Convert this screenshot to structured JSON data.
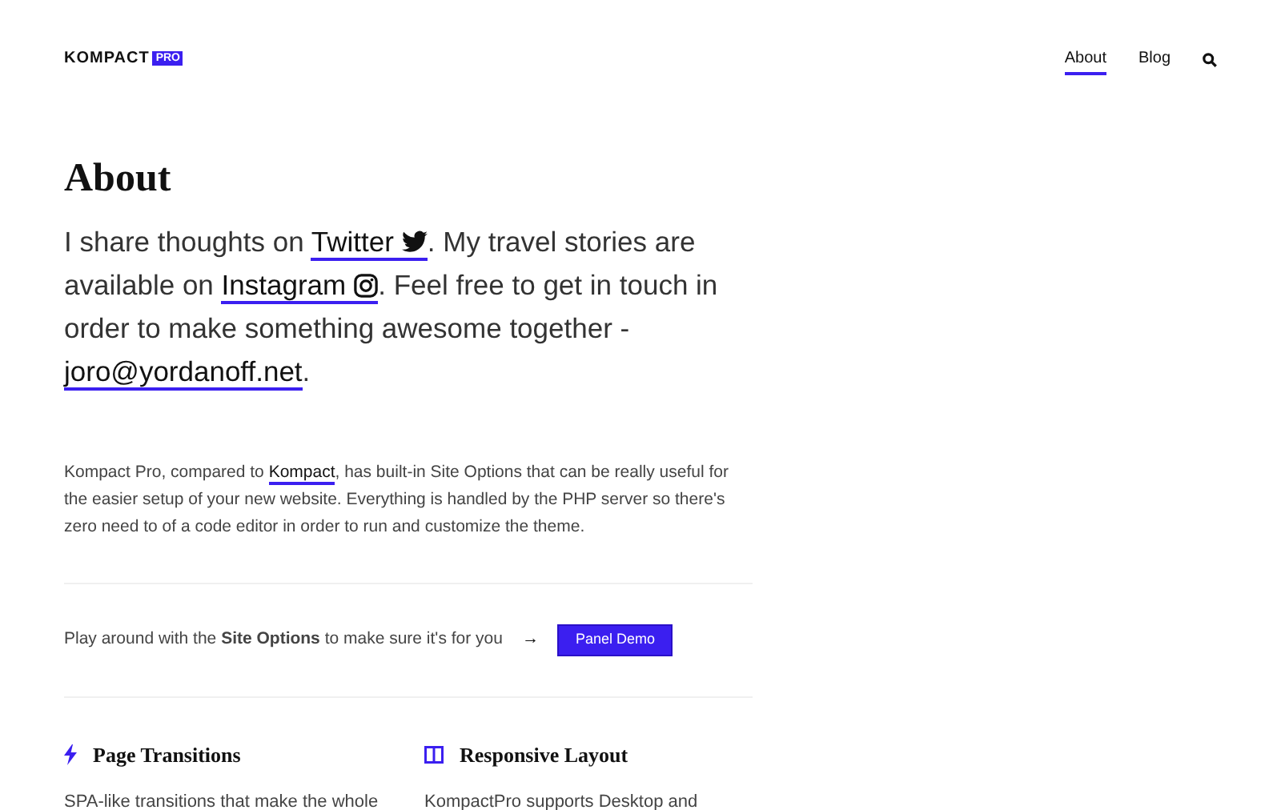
{
  "header": {
    "logo": "KOMPACT",
    "logo_badge": "PRO",
    "nav": [
      {
        "label": "About",
        "selected": true
      },
      {
        "label": "Blog",
        "selected": false
      }
    ]
  },
  "title": "About",
  "intro": [
    {
      "kind": "text",
      "text": "I share thoughts on "
    },
    {
      "kind": "twitter-link",
      "text": "Twitter"
    },
    {
      "kind": "text",
      "text": ". My travel stories are available on "
    },
    {
      "kind": "instagram-link",
      "text": "Instagram"
    },
    {
      "kind": "text",
      "text": ". Feel free to get in touch in order to make something awesome together - "
    },
    {
      "kind": "link",
      "text": "joro@yordanoff.net"
    },
    {
      "kind": "text",
      "text": "."
    }
  ],
  "description": [
    {
      "kind": "text",
      "text": "Kompact Pro, compared to "
    },
    {
      "kind": "link",
      "text": "Kompact"
    },
    {
      "kind": "text",
      "text": ", has built-in Site Options that can be really useful for the easier setup of your new website. Everything is handled by the PHP server so there's zero need to of a code editor in order to run and customize the theme."
    }
  ],
  "cta": {
    "text": "Play around with the **Site Options** to make sure it's for you",
    "arrow": "→",
    "button": "Panel Demo"
  },
  "features": [
    {
      "kind": "bolt",
      "title": "Page Transitions",
      "text": "SPA-like transitions that make the whole"
    },
    {
      "kind": "layout",
      "title": "Responsive Layout",
      "text": "KompactPro supports Desktop and"
    }
  ]
}
